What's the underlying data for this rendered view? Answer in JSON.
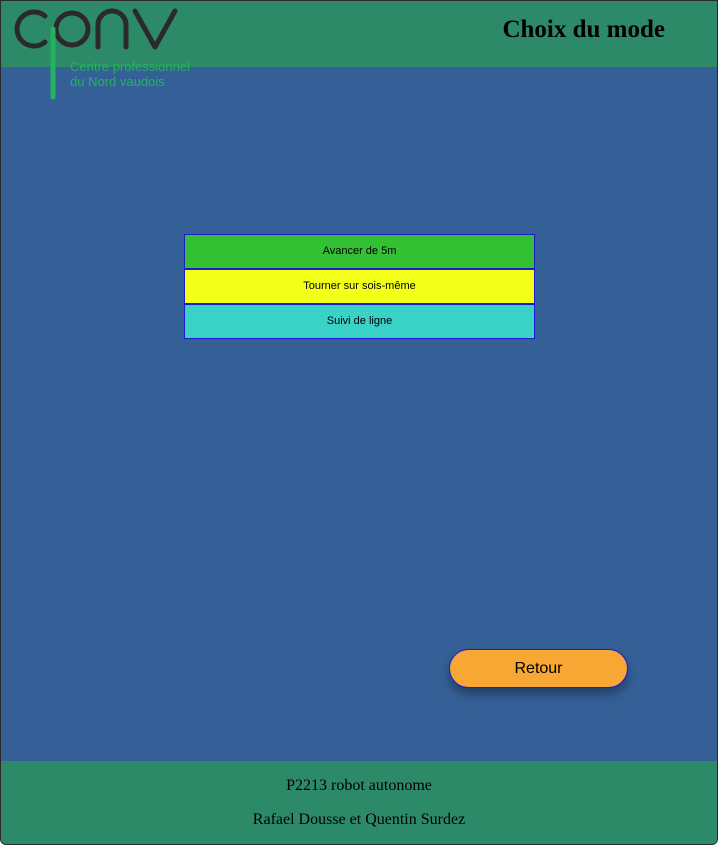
{
  "header": {
    "logo": {
      "brand": "cpnv",
      "line1": "Centre professionnel",
      "line2": "du Nord vaudois",
      "color": "#23b35c"
    },
    "title": "Choix du mode"
  },
  "modes": [
    {
      "label": "Avancer de 5m",
      "color": "#33c133"
    },
    {
      "label": "Tourner sur sois-même",
      "color": "#f2ff19"
    },
    {
      "label": "Suivi de ligne",
      "color": "#3ad1c6"
    }
  ],
  "retour_label": "Retour",
  "footer": {
    "project": "P2213 robot autonome",
    "authors": "Rafael Dousse et Quentin Surdez"
  },
  "colors": {
    "header_footer": "#2d8a68",
    "background": "#356097",
    "retour": "#f8a634",
    "button_border": "#1b1bd6"
  }
}
